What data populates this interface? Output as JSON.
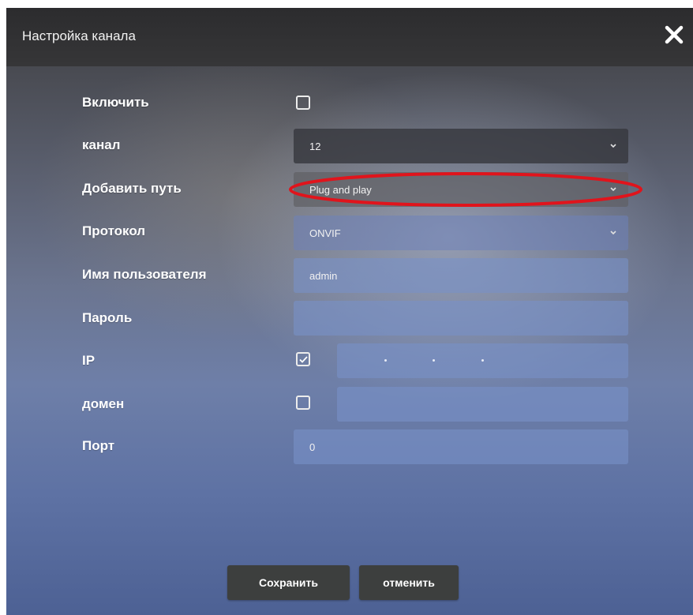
{
  "dialog": {
    "title": "Настройка канала",
    "close_icon": "close-icon"
  },
  "form": {
    "enable": {
      "label": "Включить",
      "checked": false
    },
    "channel": {
      "label": "канал",
      "value": "12"
    },
    "add_path": {
      "label": "Добавить путь",
      "value": "Plug and play"
    },
    "protocol": {
      "label": "Протокол",
      "value": "ONVIF"
    },
    "username": {
      "label": "Имя пользователя",
      "value": "admin"
    },
    "password": {
      "label": "Пароль",
      "value": ""
    },
    "ip": {
      "label": "IP",
      "checked": true,
      "value": ". . ."
    },
    "domain": {
      "label": "домен",
      "checked": false,
      "value": ""
    },
    "port": {
      "label": "Порт",
      "value": "0"
    }
  },
  "buttons": {
    "save": "Сохранить",
    "cancel": "отменить"
  },
  "colors": {
    "highlight": "#e0141c",
    "titlebar": "#2f2f31",
    "button": "#3d3f3e"
  }
}
